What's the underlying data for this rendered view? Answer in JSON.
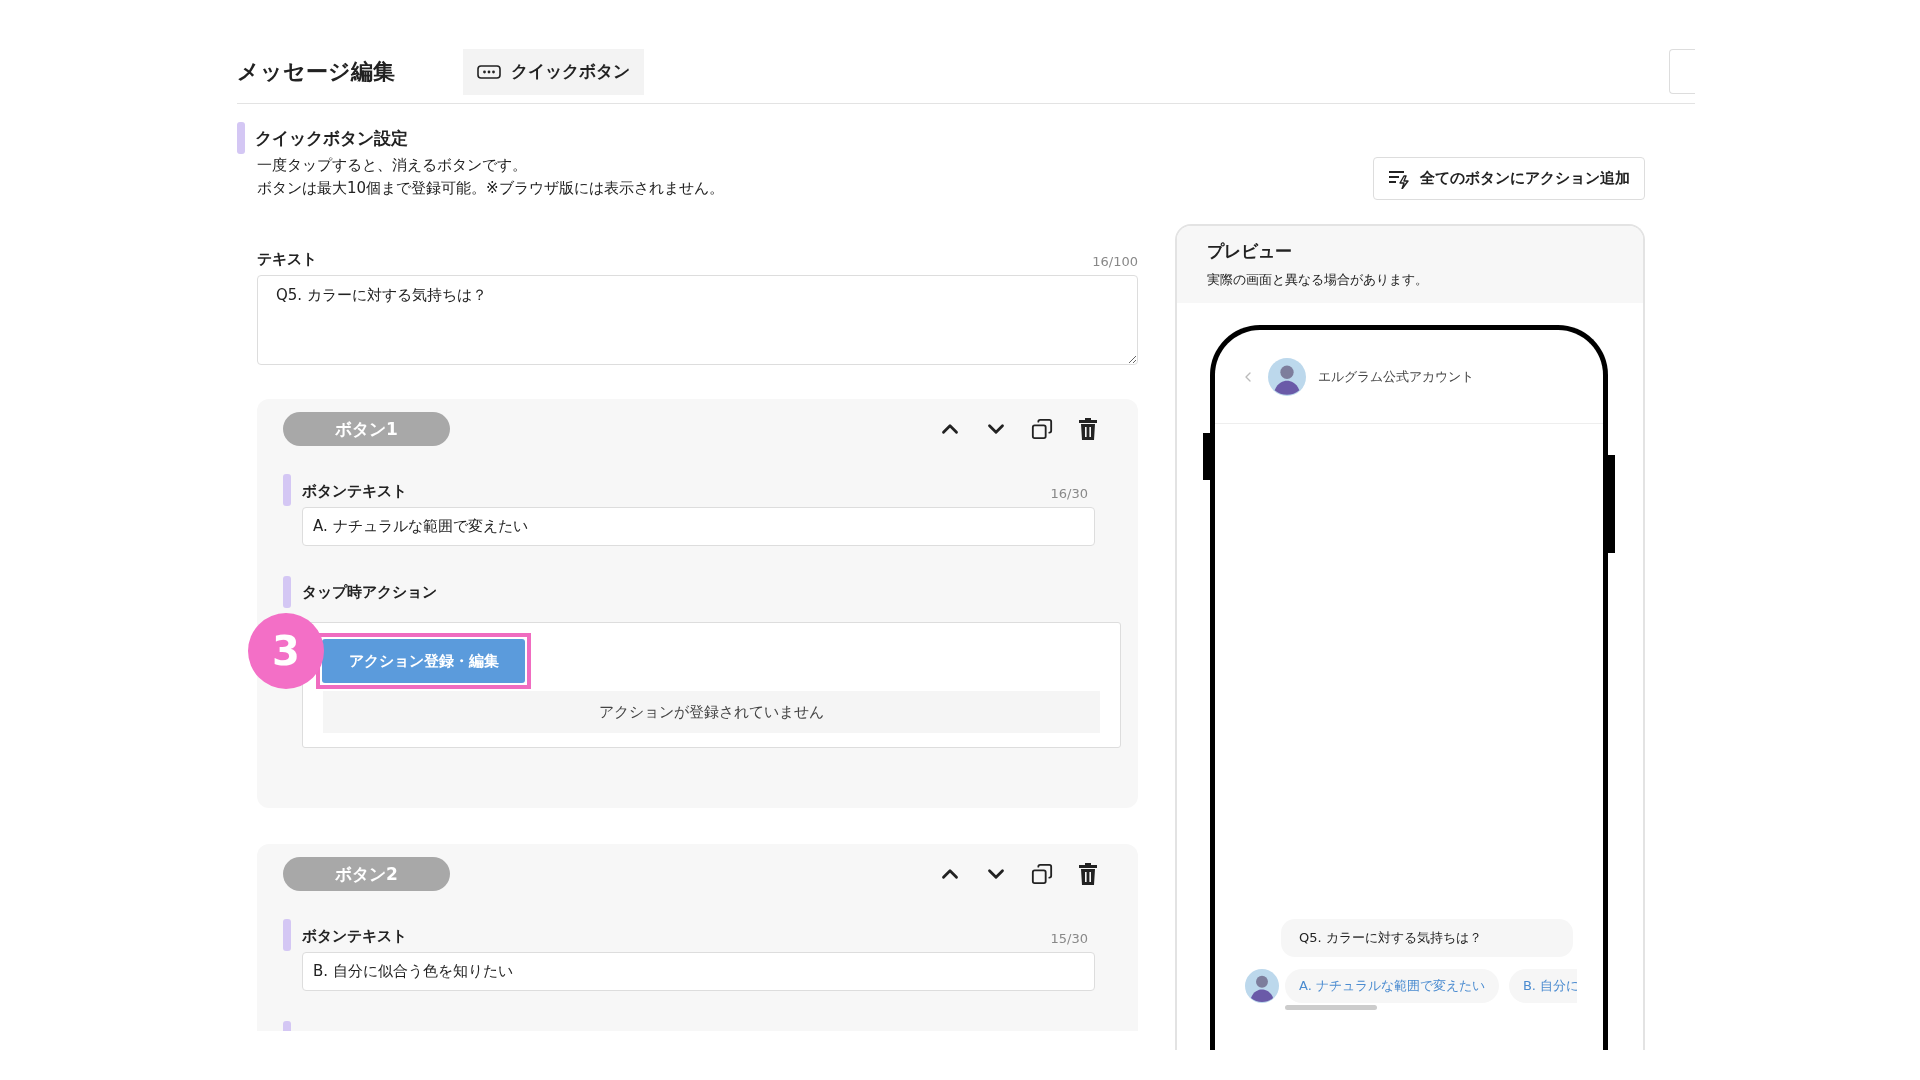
{
  "header": {
    "title": "メッセージ編集",
    "tab": "クイックボタン"
  },
  "section": {
    "title": "クイックボタン設定",
    "description": [
      "一度タップすると、消えるボタンです。",
      "ボタンは最大10個まで登録可能。※ブラウザ版には表示されません。"
    ],
    "add_action_button": "全てのボタンにアクション追加"
  },
  "text_field": {
    "label": "テキスト",
    "counter": "16/100",
    "value": "Q5. カラーに対する気持ちは？"
  },
  "buttons": [
    {
      "name": "ボタン1",
      "text_label": "ボタンテキスト",
      "counter": "16/30",
      "value": "A. ナチュラルな範囲で変えたい",
      "action": {
        "label": "タップ時アクション",
        "button": "アクション登録・編集",
        "empty_message": "アクションが登録されていません",
        "step_badge": "3"
      }
    },
    {
      "name": "ボタン2",
      "text_label": "ボタンテキスト",
      "counter": "15/30",
      "value": "B. 自分に似合う色を知りたい"
    }
  ],
  "preview": {
    "title": "プレビュー",
    "note": "実際の画面と異なる場合があります。",
    "account_name": "エルグラム公式アカウント",
    "message": "Q5. カラーに対する気持ちは？",
    "quick_replies": [
      "A. ナチュラルな範囲で変えたい",
      "B. 自分に"
    ]
  }
}
